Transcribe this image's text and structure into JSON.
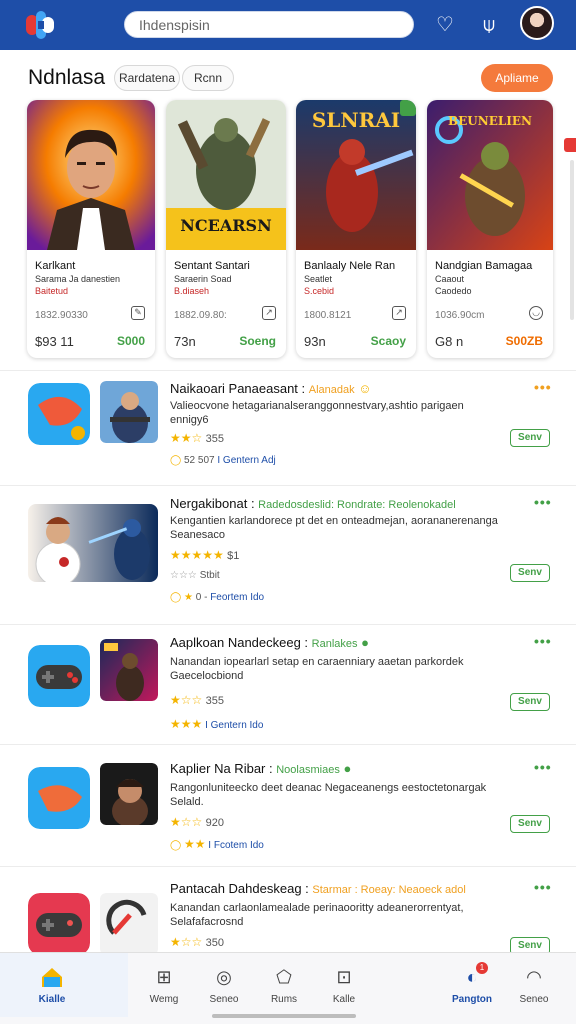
{
  "header": {
    "search_value": "Ihdenspisin",
    "icons": [
      "app-logo-icon",
      "heart-icon",
      "person-icon",
      "profile-avatar"
    ]
  },
  "section": {
    "title": "Ndnlasa",
    "chips": [
      "Rardatena",
      "Rcnn"
    ],
    "cta": "Apliame"
  },
  "cards": [
    {
      "art_title": "",
      "title": "Karlkant",
      "subtitle": "Sarama Ja danestien",
      "red": "Baitetud",
      "meta": "1832.90330",
      "price": "$93 11",
      "cta": "S000",
      "cta_color": "green"
    },
    {
      "art_title": "NCEARSN",
      "title": "Sentant Santari",
      "subtitle": "Saraerin Soad",
      "red": "B.diaseh",
      "meta": "1882.09.80:",
      "price": "73n",
      "cta": "Soeng",
      "cta_color": "green"
    },
    {
      "art_title": "SLNRAI",
      "title": "Banlaaly Nele Ran",
      "subtitle": "Seatlet",
      "red": "S.cebid",
      "meta": "1800.8121",
      "price": "93n",
      "cta": "Scaoy",
      "cta_color": "green"
    },
    {
      "art_title": "BEUNELIEN",
      "title": "Nandgian Bamagaa",
      "subtitle": "Caaout",
      "red": "Caodedo",
      "meta": "1036.90cm",
      "price": "G8 n",
      "cta": "S00ZB",
      "cta_color": "orange"
    }
  ],
  "list": [
    {
      "title": "Naikaoari Panaeasant",
      "tag": "Alanadak",
      "tag_color": "#f0a020",
      "desc": "Valieocvone hetagarianalseranggonnestvary,ashtio parigaen ennigy6",
      "rating_line": "★★☆",
      "rating_num": "355",
      "meta": "52  507",
      "meta_link": "I Gentern Adj",
      "button": "Senv"
    },
    {
      "title": "Nergakibonat",
      "tag": "Radedosdeslid: Rondrate: Reolenokadel",
      "tag_color": "#43a047",
      "desc": "Kengantien karlandorece pt det en onteadmejan, aorananerenanga Seanesaco",
      "rating_line": "★★★★★",
      "rating_num": "$1",
      "meta": "Stbit",
      "meta2": "0 -",
      "meta_link": "Feortem Ido",
      "button": "Senv"
    },
    {
      "title": "Aaplkoan Nandeckeeg :",
      "tag": "Ranlakes",
      "tag_color": "#43a047",
      "desc": "Nanandan iopearlarl setap en caraenniary aaetan parkordek Gaecelocbiond",
      "rating_line": "★☆☆",
      "rating_num": "355",
      "meta": "★★★",
      "meta_link": "I Gentern Ido",
      "button": "Senv"
    },
    {
      "title": "Kaplier Na Ribar :",
      "tag": "Noolasmiaes",
      "tag_color": "#43a047",
      "desc": "Rangonluniteecko deet deanac Negaceanengs eestoctetonargak Selald.",
      "rating_line": "★☆☆",
      "rating_num": "920",
      "meta": "★★",
      "meta_link": "I Fcotem Ido",
      "button": "Senv"
    },
    {
      "title": "Pantacah Dahdeskeag",
      "tag": "Starmar : Roeay: Neaoeck adol",
      "tag_color": "#f0a020",
      "desc": "Kanandan carlaonlamealade perinaooritty adeanerorrentyat, Selafafacrosnd",
      "rating_line": "★☆☆",
      "rating_num": "350",
      "meta": "",
      "meta_link": "",
      "button": "Senv"
    }
  ],
  "nav": [
    {
      "label": "Kialle",
      "icon": "home-icon",
      "active": true
    },
    {
      "label": "Wemg",
      "icon": "grid-icon",
      "active": false
    },
    {
      "label": "Seneo",
      "icon": "compass-icon",
      "active": false
    },
    {
      "label": "Rums",
      "icon": "pentagon-icon",
      "active": false
    },
    {
      "label": "Kalle",
      "icon": "square-icon",
      "active": false
    },
    {
      "label": "Pangton",
      "icon": "messenger-icon",
      "active": true,
      "badge": "1"
    },
    {
      "label": "Seneo",
      "icon": "profile-icon",
      "active": false
    }
  ],
  "colors": {
    "brand": "#1e4ea8",
    "accent": "#f47a3c",
    "green": "#43a047",
    "star": "#f4b400"
  }
}
